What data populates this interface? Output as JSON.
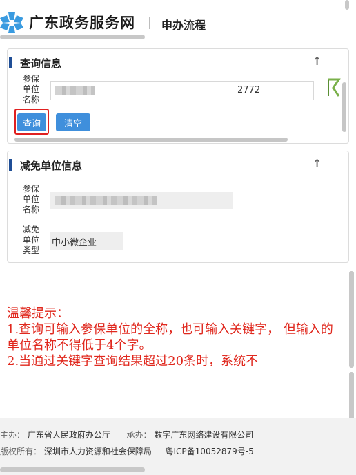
{
  "header": {
    "site_title": "广东政务服务网",
    "subtitle": "申办流程",
    "logo_icon": "snowflake-logo-icon"
  },
  "query_panel": {
    "title": "查询信息",
    "collapse_icon": "arrow-up-icon",
    "unit_label": "参保单位名称",
    "unit_label_lines": [
      "参保",
      "单位",
      "名称"
    ],
    "unit_value_suffix": "2772",
    "buttons": {
      "search": "查询",
      "clear": "清空"
    },
    "accent_color": "#1f4e96",
    "highlight_color": "#e02020"
  },
  "relief_panel": {
    "title": "减免单位信息",
    "collapse_icon": "arrow-up-icon",
    "unit_name_label_lines": [
      "参保",
      "单位",
      "名称"
    ],
    "unit_type_label_lines": [
      "减免",
      "单位",
      "类型"
    ],
    "unit_type_value": "中小微企业"
  },
  "tips": {
    "heading": "温馨提示：",
    "lines": [
      "1.查询可输入参保单位的全称，也可输入关键字， 但输入的单位名称不得低于4个字。",
      "2.当通过关键字查询结果超过20条时，系统不"
    ],
    "color": "#e0281e"
  },
  "footer": {
    "host_label": "主办：",
    "host_value": "广东省人民政府办公厅",
    "undertake_label": "承办：",
    "undertake_value": "数字广东网络建设有限公司",
    "copyright_label": "版权所有：",
    "copyright_value": "深圳市人力资源和社会保障局",
    "icp": "粤ICP备10052879号-5"
  }
}
